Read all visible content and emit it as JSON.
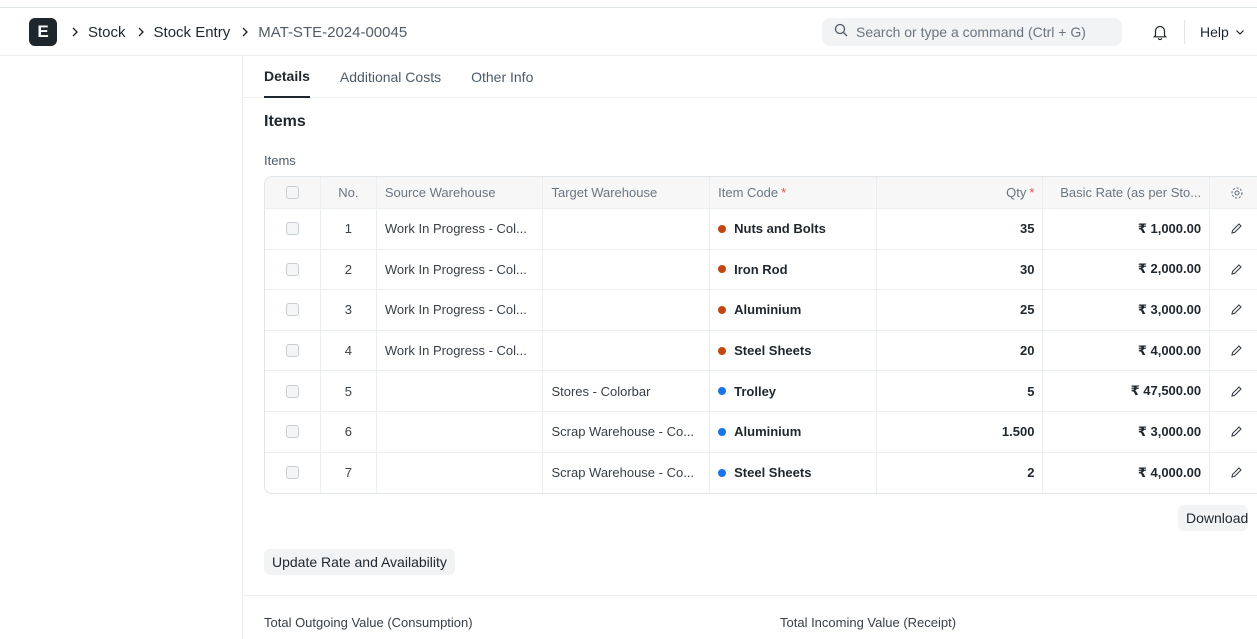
{
  "breadcrumbs": [
    "Stock",
    "Stock Entry",
    "MAT-STE-2024-00045"
  ],
  "logo_letter": "E",
  "search": {
    "placeholder": "Search or type a command (Ctrl + G)"
  },
  "help_label": "Help",
  "tabs": [
    "Details",
    "Additional Costs",
    "Other Info"
  ],
  "section_title": "Items",
  "field_label": "Items",
  "table": {
    "headers": {
      "no": "No.",
      "source": "Source Warehouse",
      "target": "Target Warehouse",
      "item": "Item Code",
      "qty": "Qty",
      "rate": "Basic Rate (as per Sto..."
    },
    "rows": [
      {
        "no": "1",
        "source": "Work In Progress - Col...",
        "target": "",
        "item": "Nuts and Bolts",
        "qty": "35",
        "rate": "₹ 1,000.00",
        "dot_color": "#c0470f"
      },
      {
        "no": "2",
        "source": "Work In Progress - Col...",
        "target": "",
        "item": "Iron Rod",
        "qty": "30",
        "rate": "₹ 2,000.00",
        "dot_color": "#c0470f"
      },
      {
        "no": "3",
        "source": "Work In Progress - Col...",
        "target": "",
        "item": "Aluminium",
        "qty": "25",
        "rate": "₹ 3,000.00",
        "dot_color": "#c0470f"
      },
      {
        "no": "4",
        "source": "Work In Progress - Col...",
        "target": "",
        "item": "Steel Sheets",
        "qty": "20",
        "rate": "₹ 4,000.00",
        "dot_color": "#c0470f"
      },
      {
        "no": "5",
        "source": "",
        "target": "Stores - Colorbar",
        "item": "Trolley",
        "qty": "5",
        "rate": "₹ 47,500.00",
        "dot_color": "#1a73e8"
      },
      {
        "no": "6",
        "source": "",
        "target": "Scrap Warehouse - Co...",
        "item": "Aluminium",
        "qty": "1.500",
        "rate": "₹ 3,000.00",
        "dot_color": "#1a73e8"
      },
      {
        "no": "7",
        "source": "",
        "target": "Scrap Warehouse - Co...",
        "item": "Steel Sheets",
        "qty": "2",
        "rate": "₹ 4,000.00",
        "dot_color": "#1a73e8"
      }
    ]
  },
  "download_label": "Download",
  "update_button_label": "Update Rate and Availability",
  "totals": {
    "outgoing_label": "Total Outgoing Value (Consumption)",
    "incoming_label": "Total Incoming Value (Receipt)"
  }
}
